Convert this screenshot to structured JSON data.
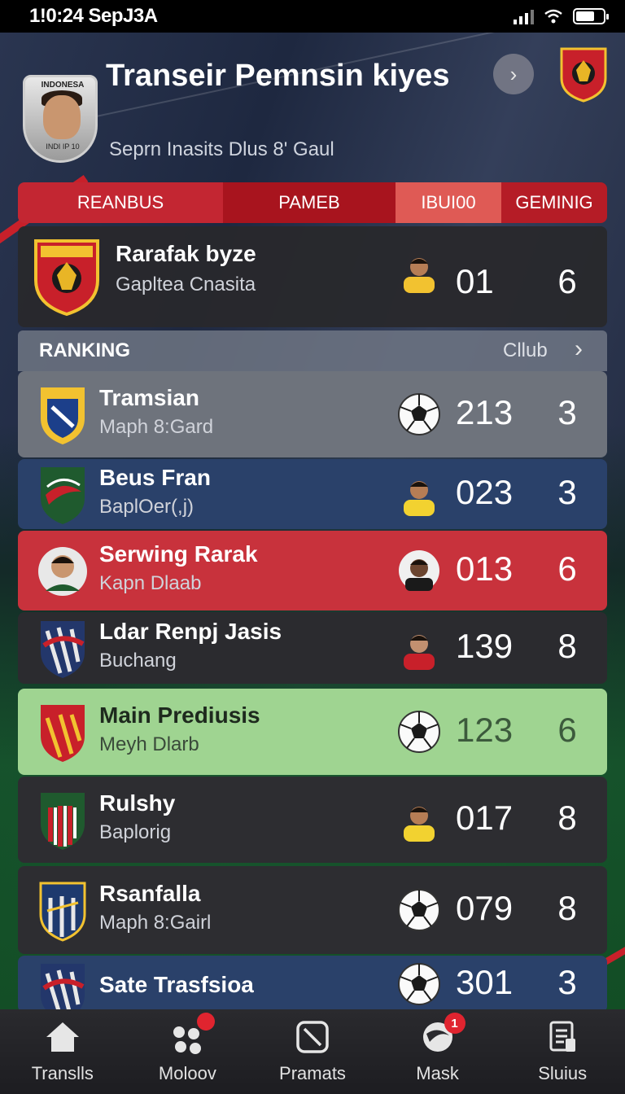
{
  "status_bar": {
    "time": "1!0:24 SepJ3A"
  },
  "header": {
    "title": "Transeir Pemnsin kiyes",
    "subtitle": "Seprn Inasits Dlus 8' Gaul",
    "avatar_label": "INDONESA",
    "avatar_sub": "INDI IP 10"
  },
  "tabs": [
    {
      "label": "REANBUS"
    },
    {
      "label": "PAMEB"
    },
    {
      "label": "IBUI00"
    },
    {
      "label": "GEMINIG"
    }
  ],
  "captain": {
    "name": "Rarafak byze",
    "sub": "Gapltea Cnasita",
    "value": "01",
    "pos": "6"
  },
  "ranking": {
    "label": "RANKING",
    "club_label": "Cllub"
  },
  "rows": [
    {
      "name": "Tramsian",
      "sub": "Maph 8:Gard",
      "value": "213",
      "pos": "3",
      "bg": "#6e737c",
      "crest": "gold-blue",
      "thumb": "ball"
    },
    {
      "name": "Beus Fran",
      "sub": "BaplOer(,j)",
      "value": "023",
      "pos": "3",
      "bg": "#2a416a",
      "crest": "green-red",
      "thumb": "player-yellow"
    },
    {
      "name": "Serwing Rarak",
      "sub": "Kapn Dlaab",
      "value": "013",
      "pos": "6",
      "bg": "#c8323c",
      "crest": "avatar",
      "thumb": "player-dark"
    },
    {
      "name": "Ldar Renpj Jasis",
      "sub": "Buchang",
      "value": "139",
      "pos": "8",
      "bg": "#2b2b2f",
      "crest": "navy-red",
      "thumb": "player-red"
    },
    {
      "name": "Main Prediusis",
      "sub": "Meyh Dlarb",
      "value": "123",
      "pos": "6",
      "bg": "#9fd491",
      "crest": "red-gold",
      "thumb": "ball"
    },
    {
      "name": "Rulshy",
      "sub": "Baplorig",
      "value": "017",
      "pos": "8",
      "bg": "#2d2d31",
      "crest": "green-stripe",
      "thumb": "player-yellow"
    },
    {
      "name": "Rsanfalla",
      "sub": "Maph 8:Gairl",
      "value": "079",
      "pos": "8",
      "bg": "#2d2d31",
      "crest": "blue-gold",
      "thumb": "ball"
    },
    {
      "name": "Sate Trasfsioa",
      "sub": "",
      "value": "301",
      "pos": "3",
      "bg": "#2a416a",
      "crest": "navy-red",
      "thumb": "ball"
    }
  ],
  "nav": [
    {
      "label": "Translls",
      "icon": "home-icon"
    },
    {
      "label": "Moloov",
      "icon": "dots-icon",
      "badge": ""
    },
    {
      "label": "Pramats",
      "icon": "slash-icon"
    },
    {
      "label": "Mask",
      "icon": "ball-swirl-icon",
      "badge": "1"
    },
    {
      "label": "Sluius",
      "icon": "document-icon"
    }
  ],
  "colors": {
    "accent_red": "#c32632",
    "highlight_green": "#9fd491",
    "row_blue": "#2a416a"
  }
}
